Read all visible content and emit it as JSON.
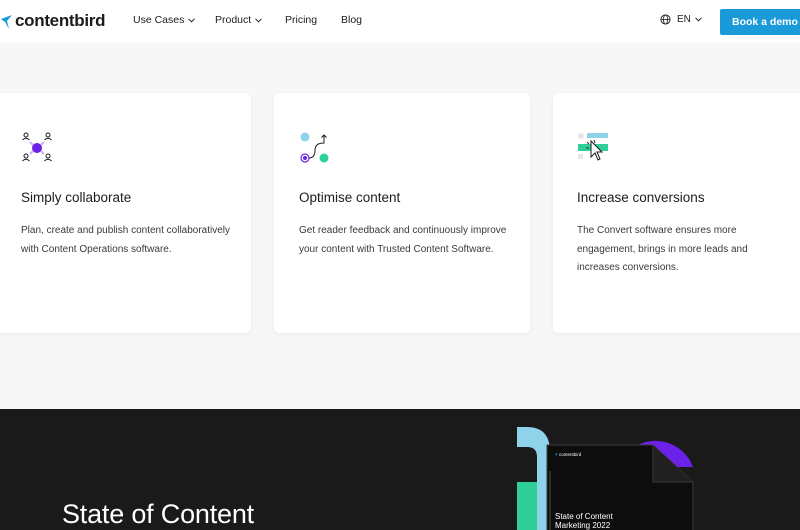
{
  "nav": {
    "logo": "contentbird",
    "items": [
      {
        "label": "Use Cases",
        "dropdown": true
      },
      {
        "label": "Product",
        "dropdown": true
      },
      {
        "label": "Pricing",
        "dropdown": false
      },
      {
        "label": "Blog",
        "dropdown": false
      }
    ],
    "language": "EN",
    "cta": "Book a demo"
  },
  "features": [
    {
      "icon": "people-network-icon",
      "title": "Simply collaborate",
      "text": "Plan, create and publish content collaboratively with Content Operations software."
    },
    {
      "icon": "optimise-path-icon",
      "title": "Optimise content",
      "text": "Get reader feedback and continuously improve your content with Trusted Content Software."
    },
    {
      "icon": "conversion-cursor-icon",
      "title": "Increase conversions",
      "text": "The Convert software ensures more engagement, brings in more leads and increases conversions."
    }
  ],
  "report": {
    "heading": "State of Content",
    "cover_brand": "contentbird",
    "cover_title_line1": "State of Content",
    "cover_title_line2": "Marketing 2022"
  },
  "colors": {
    "accent": "#1a9ad9",
    "purple": "#6b21e8",
    "green": "#2ecf9a",
    "light_blue": "#8fd3ea",
    "dark_bg": "#1a1a1a"
  }
}
